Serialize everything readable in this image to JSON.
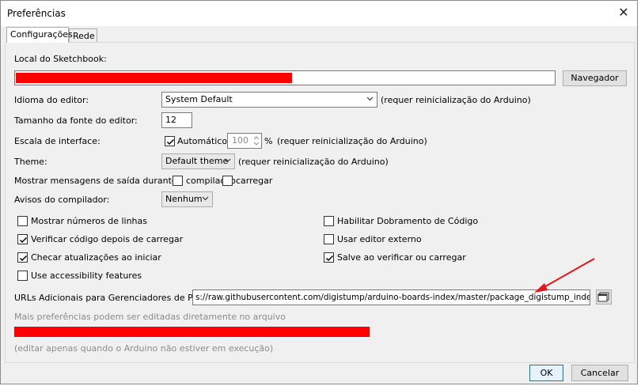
{
  "window": {
    "title": "Preferências",
    "close_symbol": "✕"
  },
  "tabs": [
    {
      "label": "Configurações",
      "active": true
    },
    {
      "label": "Rede",
      "active": false
    }
  ],
  "sketchbook": {
    "label": "Local do Sketchbook:",
    "browse_button": "Navegador"
  },
  "editor_language": {
    "label": "Idioma do editor:",
    "value": "System Default",
    "note": "(requer reinicialização do Arduino)"
  },
  "font_size": {
    "label": "Tamanho da fonte do editor:",
    "value": "12"
  },
  "interface_scale": {
    "label": "Escala de interface:",
    "auto_label": "Automático",
    "auto_checked": true,
    "value": "100",
    "unit": "%",
    "note": "(requer reinicialização do Arduino)"
  },
  "theme": {
    "label": "Theme:",
    "value": "Default theme",
    "note": "(requer reinicialização do Arduino)"
  },
  "verbose_output": {
    "label": "Mostrar mensagens de saída durante:",
    "compile_label": "compilação",
    "compile_checked": false,
    "upload_label": "carregar",
    "upload_checked": false
  },
  "compiler_warnings": {
    "label": "Avisos do compilador:",
    "value": "Nenhum"
  },
  "options_left": [
    {
      "label": "Mostrar números de linhas",
      "checked": false
    },
    {
      "label": "Verificar código depois de carregar",
      "checked": true
    },
    {
      "label": "Checar atualizações ao iniciar",
      "checked": true
    },
    {
      "label": "Use accessibility features",
      "checked": false
    }
  ],
  "options_right": [
    {
      "label": "Habilitar Dobramento de Código",
      "checked": false
    },
    {
      "label": "Usar editor externo",
      "checked": false
    },
    {
      "label": "Salve ao verificar ou carregar",
      "checked": true
    }
  ],
  "board_urls": {
    "label": "URLs Adicionais para Gerenciadores de Placas:",
    "value": "s://raw.githubusercontent.com/digistump/arduino-boards-index/master/package_digistump_index.json"
  },
  "more_prefs_note": "Mais preferências podem ser editadas diretamente no arquivo",
  "edit_only_note": "(editar apenas quando o Arduino não estiver em execução)",
  "footer": {
    "ok_label": "OK",
    "cancel_label": "Cancelar"
  },
  "colors": {
    "redaction": "#ff0000",
    "annotation_arrow": "#e8141b"
  }
}
